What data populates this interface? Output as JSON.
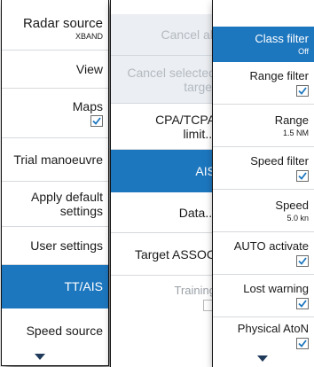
{
  "left_menu": {
    "items": [
      {
        "label": "Radar source",
        "value": "XBAND"
      },
      {
        "label": "View"
      },
      {
        "label": "Maps"
      },
      {
        "label": "Trial manoeuvre"
      },
      {
        "label": "Apply default settings"
      },
      {
        "label": "User settings"
      },
      {
        "label": "TT/AIS"
      },
      {
        "label": "Speed source"
      }
    ]
  },
  "middle_menu": {
    "items": [
      {
        "label": "Cancel all"
      },
      {
        "label": "Cancel selected target"
      },
      {
        "label": "CPA/TCPA limit..."
      },
      {
        "label": "AIS"
      },
      {
        "label": "Data..."
      },
      {
        "label": "Target ASSOC"
      },
      {
        "label": "Training"
      }
    ]
  },
  "right_menu": {
    "items": [
      {
        "label": "Class filter",
        "value": "Off"
      },
      {
        "label": "Range filter"
      },
      {
        "label": "Range",
        "value": "1.5 NM"
      },
      {
        "label": "Speed filter"
      },
      {
        "label": "Speed",
        "value": "5.0 kn"
      },
      {
        "label": "AUTO activate"
      },
      {
        "label": "Lost warning"
      },
      {
        "label": "Physical AtoN"
      }
    ]
  },
  "colors": {
    "accent": "#1d77bf",
    "check": "#1d77bf",
    "disabled_text": "#9aa0a6"
  }
}
